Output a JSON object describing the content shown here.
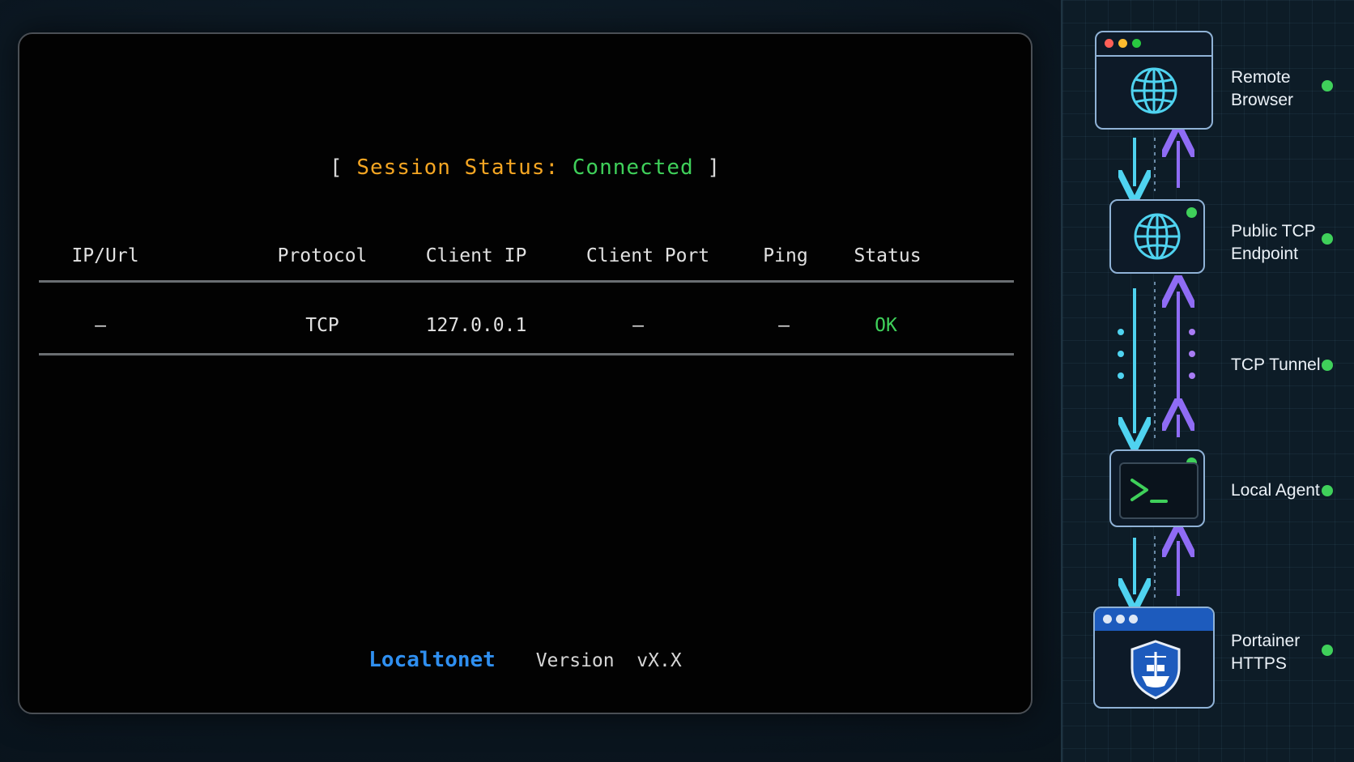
{
  "session": {
    "open_bracket": "[",
    "label": "Session Status:",
    "value": "Connected",
    "close_bracket": "]"
  },
  "table": {
    "headers": [
      "IP/Url",
      "Protocol",
      "Client IP",
      "Client Port",
      "Ping",
      "Status"
    ],
    "rows": [
      [
        "—",
        "TCP",
        "127.0.0.1",
        "—",
        "—",
        "OK"
      ]
    ]
  },
  "footer": {
    "brand": "Localtonet",
    "version": "Version  vX.X"
  },
  "diagram": {
    "nodes": [
      {
        "label_line1": "Remote",
        "label_line2": "Browser",
        "icon": "globe-icon",
        "status": "online"
      },
      {
        "label_line1": "Public TCP",
        "label_line2": "Endpoint",
        "icon": "globe-icon",
        "status": "online"
      },
      {
        "label_line1": "TCP Tunnel",
        "label_line2": "",
        "icon": "tunnel-arrows",
        "status": "online"
      },
      {
        "label_line1": "Local Agent",
        "label_line2": "",
        "icon": "terminal-icon",
        "status": "online"
      },
      {
        "label_line1": "Portainer",
        "label_line2": "HTTPS",
        "icon": "shield-ship-icon",
        "status": "online"
      }
    ]
  },
  "colors": {
    "accent_orange": "#f5a623",
    "ok_green": "#3fd05a",
    "brand_blue": "#2f8ff0",
    "downstream_cyan": "#4fd3f0",
    "upstream_purple": "#8f6cf5"
  }
}
